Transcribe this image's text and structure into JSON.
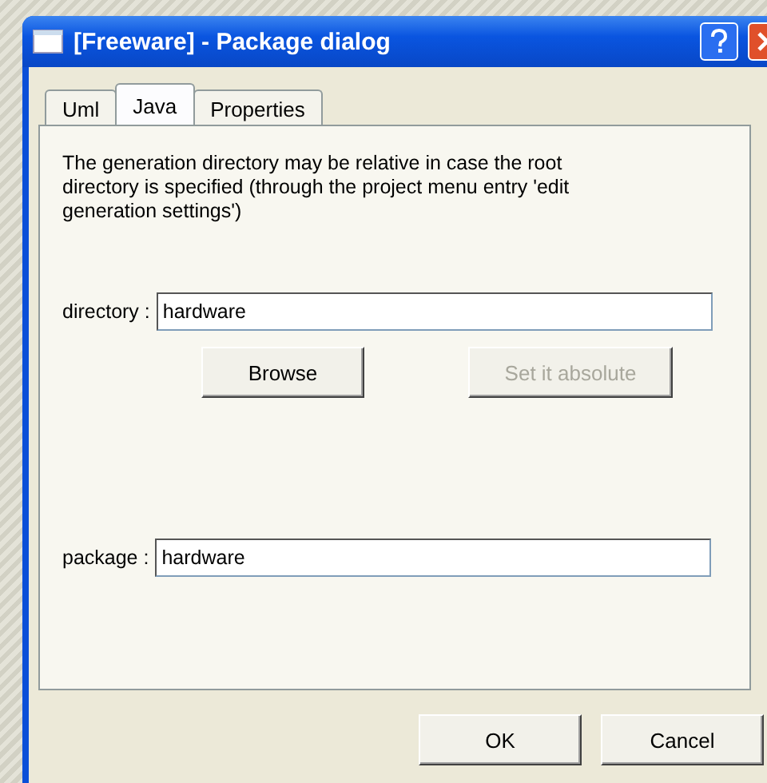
{
  "window": {
    "title": "[Freeware] - Package dialog"
  },
  "tabs": [
    {
      "label": "Uml",
      "selected": false
    },
    {
      "label": "Java",
      "selected": true
    },
    {
      "label": "Properties",
      "selected": false
    }
  ],
  "description": "The generation directory may be relative in case the root directory is specified (through the project menu entry 'edit generation settings')",
  "directory": {
    "label": "directory :",
    "value": "hardware"
  },
  "directory_buttons": [
    {
      "label": "Browse",
      "disabled": false
    },
    {
      "label": "Set it absolute",
      "disabled": true
    }
  ],
  "package": {
    "label": "package :",
    "value": "hardware"
  },
  "buttons": [
    {
      "label": "OK",
      "disabled": false
    },
    {
      "label": "Cancel",
      "disabled": false
    }
  ]
}
